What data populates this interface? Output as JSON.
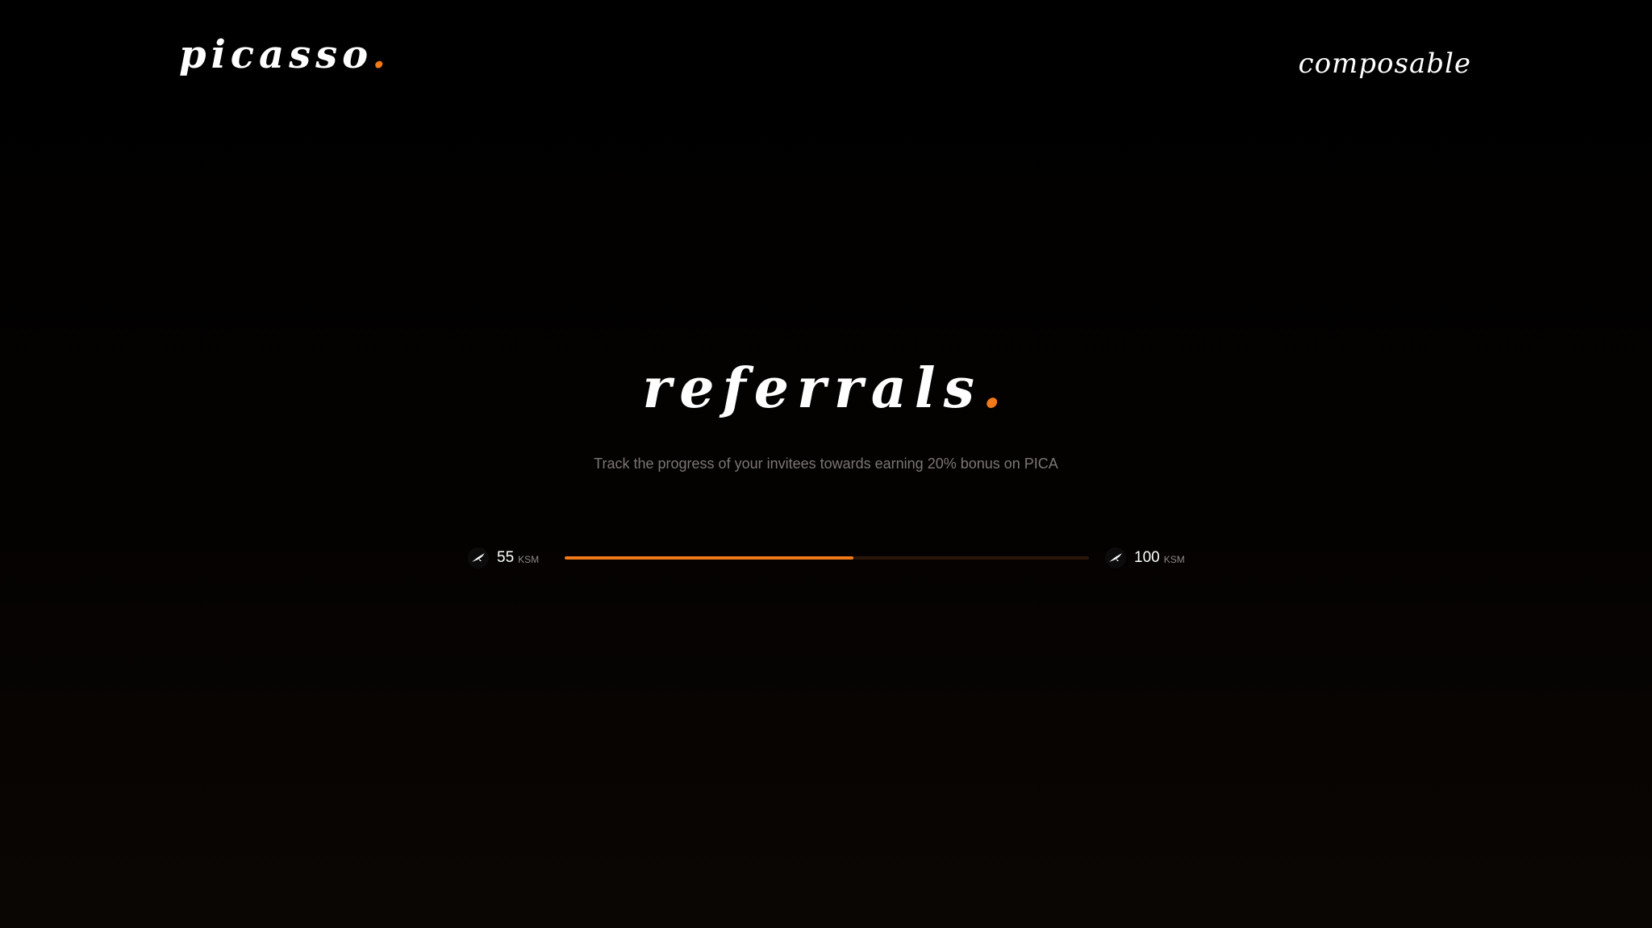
{
  "header": {
    "logo_text": "picasso",
    "logo_dot": ".",
    "brand_text": "composable"
  },
  "hero": {
    "title": "referrals",
    "title_dot": ".",
    "subtitle": "Track the progress of your invitees towards earning 20% bonus on PICA"
  },
  "progress": {
    "current_amount": "55",
    "current_unit": "KSM",
    "target_amount": "100",
    "target_unit": "KSM",
    "fill_fraction": 0.55,
    "icon": "kusama-bird-icon"
  },
  "colors": {
    "accent": "#f07a1a",
    "background": "#000000",
    "track": "#2a1608",
    "subtitle": "#7a7674"
  }
}
